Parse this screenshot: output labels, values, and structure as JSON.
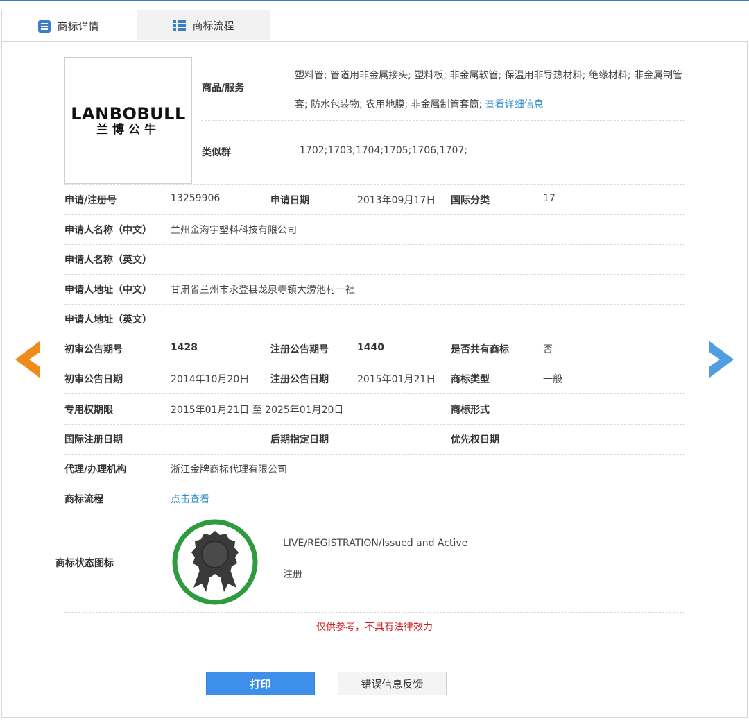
{
  "tabs": [
    {
      "label": "商标详情",
      "icon": "detail-list-icon",
      "active": true
    },
    {
      "label": "商标流程",
      "icon": "flow-list-icon",
      "active": false
    }
  ],
  "logo": {
    "en": "LANBOBULL",
    "cn": "兰博公牛"
  },
  "goods": {
    "label": "商品/服务",
    "text": "塑料管; 管道用非金属接头; 塑料板; 非金属软管; 保温用非导热材料; 绝缘材料; 非金属制管套; 防水包装物; 农用地膜; 非金属制管套筒;",
    "more_link": "查看详细信息"
  },
  "similar_group": {
    "label": "类似群",
    "value": "1702;1703;1704;1705;1706;1707;"
  },
  "fields": {
    "reg_no": {
      "label": "申请/注册号",
      "value": "13259906"
    },
    "apply_date": {
      "label": "申请日期",
      "value": "2013年09月17日"
    },
    "intl_class": {
      "label": "国际分类",
      "value": "17"
    },
    "applicant_cn": {
      "label": "申请人名称（中文）",
      "value": "兰州金海宇塑料科技有限公司"
    },
    "applicant_en": {
      "label": "申请人名称（英文）",
      "value": ""
    },
    "address_cn": {
      "label": "申请人地址（中文）",
      "value": "甘肃省兰州市永登县龙泉寺镇大涝池村一社"
    },
    "address_en": {
      "label": "申请人地址（英文）",
      "value": ""
    },
    "prelim_issue": {
      "label": "初审公告期号",
      "value": "1428"
    },
    "reg_issue": {
      "label": "注册公告期号",
      "value": "1440"
    },
    "shared": {
      "label": "是否共有商标",
      "value": "否"
    },
    "prelim_date": {
      "label": "初审公告日期",
      "value": "2014年10月20日"
    },
    "reg_date": {
      "label": "注册公告日期",
      "value": "2015年01月21日"
    },
    "mark_type": {
      "label": "商标类型",
      "value": "一般"
    },
    "exclusive_period": {
      "label": "专用权期限",
      "value": "2015年01月21日 至 2025年01月20日"
    },
    "mark_form": {
      "label": "商标形式",
      "value": ""
    },
    "intl_reg_date": {
      "label": "国际注册日期",
      "value": ""
    },
    "later_date": {
      "label": "后期指定日期",
      "value": ""
    },
    "priority_date": {
      "label": "优先权日期",
      "value": ""
    },
    "agent": {
      "label": "代理/办理机构",
      "value": "浙江金牌商标代理有限公司"
    },
    "process": {
      "label": "商标流程",
      "value": "点击查看"
    }
  },
  "status": {
    "label": "商标状态图标",
    "icon": "award-ribbon-icon",
    "text_en": "LIVE/REGISTRATION/Issued and Active",
    "text_cn": "注册"
  },
  "disclaimer": "仅供参考，不具有法律效力",
  "buttons": {
    "print": "打印",
    "feedback": "错误信息反馈"
  },
  "colors": {
    "accent": "#3d8fea",
    "link": "#2a8cc8",
    "warning": "#d02020",
    "prev_arrow": "#f08a1c",
    "next_arrow": "#4f9ee0",
    "badge_ring": "#2e9b3e"
  }
}
